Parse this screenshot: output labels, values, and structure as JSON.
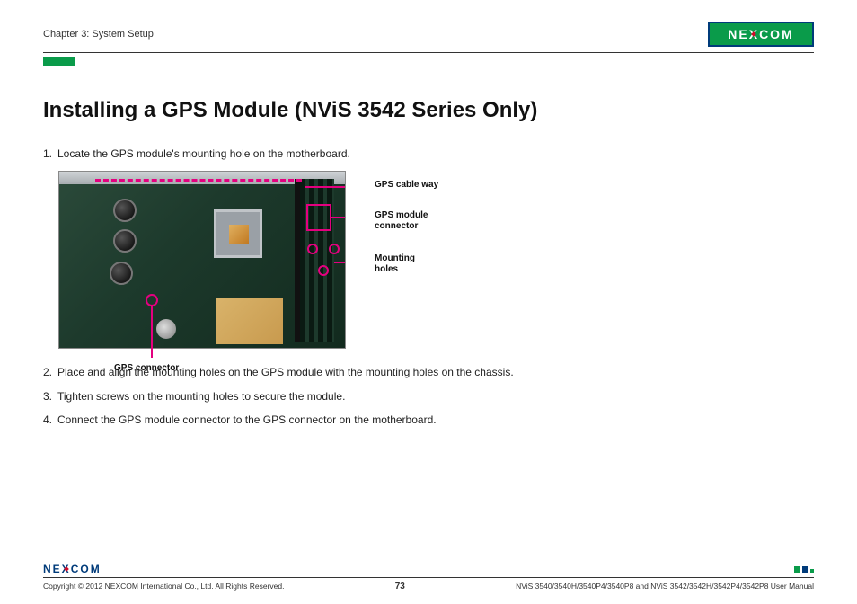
{
  "header": {
    "chapter": "Chapter 3: System Setup",
    "logo_text_left": "NE",
    "logo_text_x": "X",
    "logo_text_right": "COM"
  },
  "title": "Installing a GPS Module (NViS 3542 Series Only)",
  "steps": {
    "s1_num": "1.",
    "s1_txt": "Locate the GPS module's mounting hole on the motherboard.",
    "s2_num": "2.",
    "s2_txt": "Place and align the mounting holes on the GPS module with the mounting holes on the chassis.",
    "s3_num": "3.",
    "s3_txt": "Tighten screws on the mounting holes to secure the module.",
    "s4_num": "4.",
    "s4_txt": "Connect the GPS module connector to the GPS connector on the motherboard."
  },
  "callouts": {
    "cable": "GPS cable way",
    "connector": "GPS module connector",
    "mounting": "Mounting holes",
    "gps_connector": "GPS connector"
  },
  "footer": {
    "logo_left": "NE",
    "logo_x": "X",
    "logo_right": "COM",
    "copyright": "Copyright © 2012 NEXCOM International Co., Ltd. All Rights Reserved.",
    "page_number": "73",
    "doc_ref": "NViS 3540/3540H/3540P4/3540P8 and NViS 3542/3542H/3542P4/3542P8 User Manual"
  }
}
